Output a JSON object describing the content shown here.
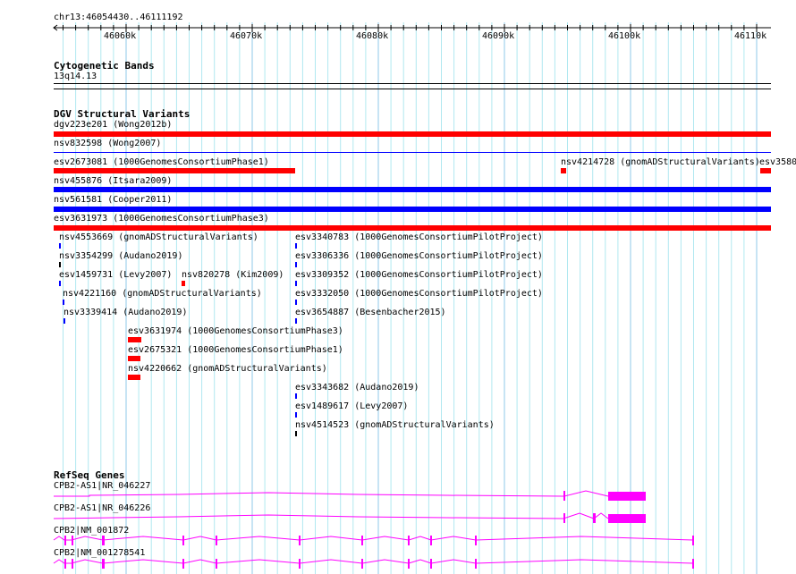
{
  "ruler": {
    "location": "chr13:46054430..46111192",
    "ticks": [
      "46060k",
      "46070k",
      "46080k",
      "46090k",
      "46100k",
      "46110k"
    ]
  },
  "cyto": {
    "title": "Cytogenetic Bands",
    "band": "13q14.13"
  },
  "dgv": {
    "title": "DGV Structural Variants",
    "features": [
      "dgv223e201 (Wong2012b)",
      "nsv832598 (Wong2007)",
      "esv2673081 (1000GenomesConsortiumPhase1)",
      "nsv4214728 (gnomADStructuralVariants)",
      "esv3580",
      "nsv455876 (Itsara2009)",
      "nsv561581 (Cooper2011)",
      "esv3631973 (1000GenomesConsortiumPhase3)",
      "nsv4553669 (gnomADStructuralVariants)",
      "nsv3354299 (Audano2019)",
      "esv1459731 (Levy2007)",
      "nsv820278 (Kim2009)",
      "nsv4221160 (gnomADStructuralVariants)",
      "nsv3339414 (Audano2019)",
      "esv3631974 (1000GenomesConsortiumPhase3)",
      "esv2675321 (1000GenomesConsortiumPhase1)",
      "nsv4220662 (gnomADStructuralVariants)",
      "esv3340783 (1000GenomesConsortiumPilotProject)",
      "esv3306336 (1000GenomesConsortiumPilotProject)",
      "esv3309352 (1000GenomesConsortiumPilotProject)",
      "esv3332050 (1000GenomesConsortiumPilotProject)",
      "esv3654887 (Besenbacher2015)",
      "esv3343682 (Audano2019)",
      "esv1489617 (Levy2007)",
      "nsv4514523 (gnomADStructuralVariants)"
    ]
  },
  "refseq": {
    "title": "RefSeq Genes",
    "genes": [
      "CPB2-AS1|NR_046227",
      "CPB2-AS1|NR_046226",
      "CPB2|NM_001872",
      "CPB2|NM_001278541"
    ]
  },
  "colors": {
    "loss": "#ff0000",
    "gain": "#0000ff",
    "gene": "#ff00ff",
    "grid": "#b0e8f0"
  }
}
